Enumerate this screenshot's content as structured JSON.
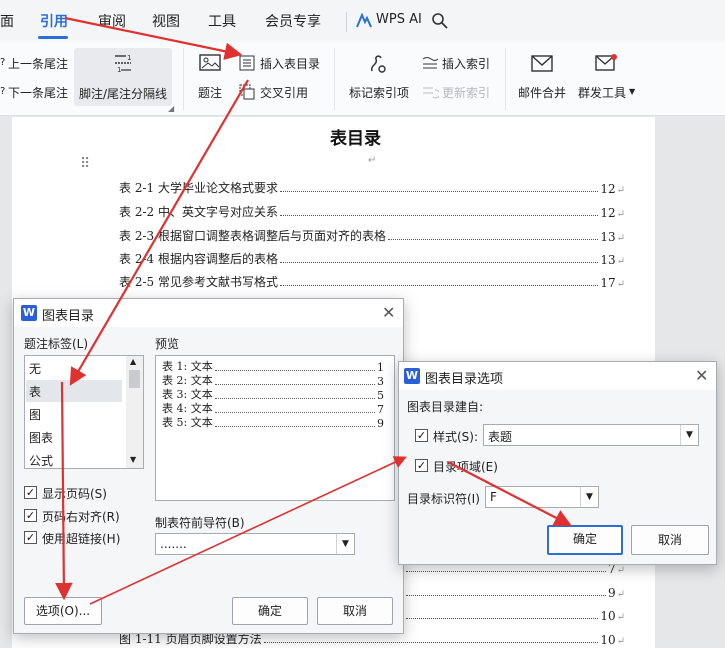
{
  "ribbon": {
    "tabs": {
      "t0": "面",
      "t1": "引用",
      "t2": "审阅",
      "t3": "视图",
      "t4": "工具",
      "t5": "会员专享",
      "t6": "WPS AI"
    },
    "prev_endnote": "上一条尾注",
    "next_endnote": "下一条尾注",
    "separator_btn": "脚注/尾注分隔线",
    "caption": "题注",
    "insert_toc_figures": "插入表目录",
    "cross_ref": "交叉引用",
    "mark_index": "标记索引项",
    "insert_index": "插入索引",
    "update_index": "更新索引",
    "mail_merge": "邮件合并",
    "mass_send": "群发工具",
    "accent": "#2b6fd6"
  },
  "document": {
    "title": "表目录",
    "para_mark": "↵",
    "toc": [
      {
        "label": "表 2-1  大学毕业论文格式要求",
        "page": "12"
      },
      {
        "label": "表 2-2  中、英文字号对应关系",
        "page": "12"
      },
      {
        "label": "表 2-3  根据窗口调整表格调整后与页面对齐的表格",
        "page": "13"
      },
      {
        "label": "表 2-4  根据内容调整后的表格",
        "page": "13"
      },
      {
        "label": "表 2-5  常见参考文献书写格式",
        "page": "17"
      }
    ],
    "lower_pages": [
      "7",
      "9",
      "10"
    ],
    "bottom_row": {
      "label": "图 1-11  页眉页脚设置方法",
      "page": "10"
    }
  },
  "dialog1": {
    "title": "图表目录",
    "caption_label_heading": "题注标签(L)",
    "caption_labels": [
      "无",
      "表",
      "图",
      "图表",
      "公式"
    ],
    "selected_label": "表",
    "preview_heading": "预览",
    "preview": [
      {
        "label": "表 1: 文本",
        "page": "1"
      },
      {
        "label": "表 2: 文本",
        "page": "3"
      },
      {
        "label": "表 3: 文本",
        "page": "5"
      },
      {
        "label": "表 4: 文本",
        "page": "7"
      },
      {
        "label": "表 5: 文本",
        "page": "9"
      }
    ],
    "show_page_numbers": "显示页码(S)",
    "right_align_page": "页码右对齐(R)",
    "use_hyperlinks": "使用超链接(H)",
    "tab_leader_heading": "制表符前导符(B)",
    "tab_leader_value": ".......",
    "options_button": "选项(O)...",
    "ok_button": "确定",
    "cancel_button": "取消"
  },
  "dialog2": {
    "title": "图表目录选项",
    "build_from": "图表目录建自:",
    "style_label": "样式(S):",
    "style_value": "表题",
    "toc_fields_label": "目录项域(E)",
    "toc_identifier_label": "目录标识符(I)",
    "toc_identifier_value": "F",
    "ok_button": "确定",
    "cancel_button": "取消"
  },
  "colors": {
    "arrow": "#e03131",
    "logo": "#2b5fd9"
  }
}
